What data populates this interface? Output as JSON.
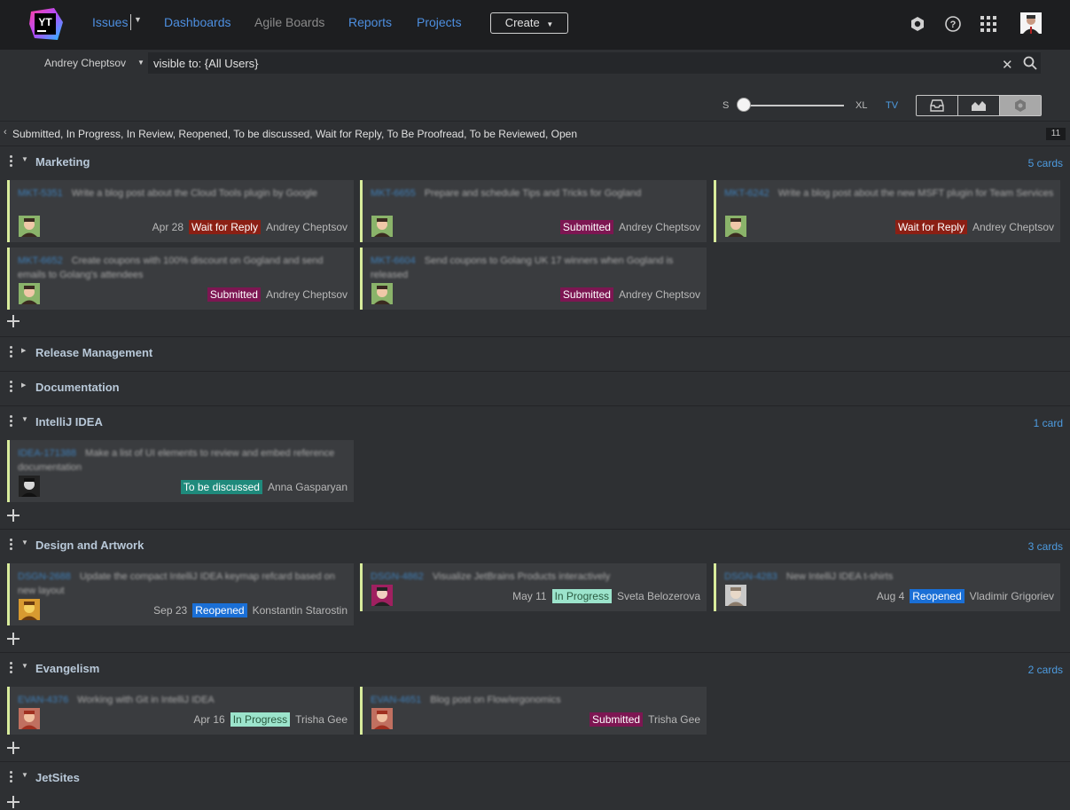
{
  "header": {
    "logo_text": "YT",
    "nav": {
      "issues": "Issues",
      "dashboards": "Dashboards",
      "agile_boards": "Agile Boards",
      "reports": "Reports",
      "projects": "Projects"
    },
    "create_label": "Create"
  },
  "search": {
    "user": "Andrey Cheptsov",
    "query": "visible to: {All Users}"
  },
  "sizes": {
    "s": "S",
    "xl": "XL",
    "tv": "TV",
    "slider_value": 0
  },
  "column": {
    "states": "Submitted, In Progress, In Review, Reopened, To be discussed, Wait for Reply, To Be Proofread, To be Reviewed, Open",
    "count": "11"
  },
  "lanes": [
    {
      "title": "Marketing",
      "count": "5 cards",
      "expanded": true,
      "cards": [
        {
          "id": "MKT-5351",
          "summary": "Write a blog post about the Cloud Tools plugin by Google",
          "date": "Apr 28",
          "state": "Wait for Reply",
          "assignee": "Andrey Cheptsov"
        },
        {
          "id": "MKT-6655",
          "summary": "Prepare and schedule Tips and Tricks for Gogland",
          "date": "",
          "state": "Submitted",
          "assignee": "Andrey Cheptsov"
        },
        {
          "id": "MKT-6242",
          "summary": "Write a blog post about the new MSFT plugin for Team Services",
          "date": "",
          "state": "Wait for Reply",
          "assignee": "Andrey Cheptsov"
        },
        {
          "id": "MKT-6652",
          "summary": "Create coupons with 100% discount on Gogland and send emails to Golang's attendees",
          "date": "",
          "state": "Submitted",
          "assignee": "Andrey Cheptsov"
        },
        {
          "id": "MKT-6604",
          "summary": "Send coupons to Golang UK 17 winners when Gogland is released",
          "date": "",
          "state": "Submitted",
          "assignee": "Andrey Cheptsov"
        }
      ]
    },
    {
      "title": "Release Management",
      "count": "",
      "expanded": false,
      "cards": []
    },
    {
      "title": "Documentation",
      "count": "",
      "expanded": false,
      "cards": []
    },
    {
      "title": "IntelliJ IDEA",
      "count": "1 card",
      "expanded": true,
      "cards": [
        {
          "id": "IDEA-171388",
          "summary": "Make a list of UI elements to review and embed reference documentation",
          "date": "",
          "state": "To be discussed",
          "assignee": "Anna Gasparyan"
        }
      ]
    },
    {
      "title": "Design and Artwork",
      "count": "3 cards",
      "expanded": true,
      "cards": [
        {
          "id": "DSGN-2688",
          "summary": "Update the compact IntelliJ IDEA keymap refcard based on new layout",
          "date": "Sep 23",
          "state": "Reopened",
          "assignee": "Konstantin Starostin"
        },
        {
          "id": "DSGN-4862",
          "summary": "Visualize JetBrains Products interactively",
          "date": "May 11",
          "state": "In Progress",
          "assignee": "Sveta Belozerova"
        },
        {
          "id": "DSGN-4283",
          "summary": "New IntelliJ IDEA t-shirts",
          "date": "Aug 4",
          "state": "Reopened",
          "assignee": "Vladimir Grigoriev"
        }
      ]
    },
    {
      "title": "Evangelism",
      "count": "2 cards",
      "expanded": true,
      "cards": [
        {
          "id": "EVAN-4376",
          "summary": "Working with Git in IntelliJ IDEA",
          "date": "Apr 16",
          "state": "In Progress",
          "assignee": "Trisha Gee"
        },
        {
          "id": "EVAN-4651",
          "summary": "Blog post on Flow/ergonomics",
          "date": "",
          "state": "Submitted",
          "assignee": "Trisha Gee"
        }
      ]
    },
    {
      "title": "JetSites",
      "count": "",
      "expanded": true,
      "cards": []
    }
  ],
  "colors": {
    "wait_for_reply": "#8b1f14",
    "submitted": "#7d1652",
    "to_be_discussed": "#1f8a7c",
    "in_progress": "#9ce4cc",
    "reopened": "#1a6fd6",
    "link": "#4d8fe0"
  }
}
